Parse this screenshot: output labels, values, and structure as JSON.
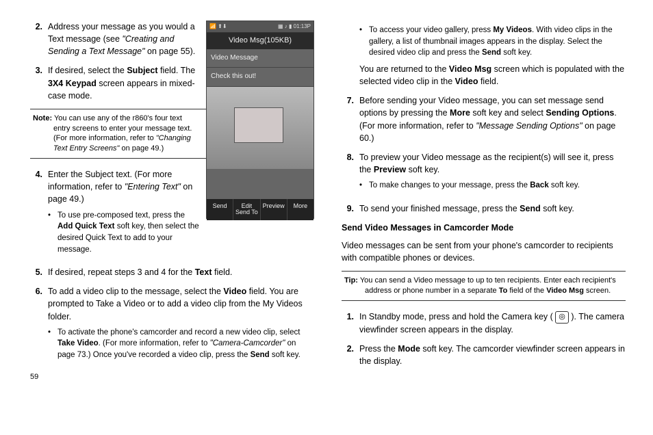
{
  "phone": {
    "status_left": "📶 ⬆⬇",
    "status_right": "▦ ♪ ▮ 01:13P",
    "title": "Video Msg(105KB)",
    "line1": "Video Message",
    "line2": "Check this out!",
    "sk1": "Send",
    "sk2a": "Edit",
    "sk2b": "Send To",
    "sk3": "Preview",
    "sk4": "More"
  },
  "left": {
    "i2_num": "2.",
    "i2a": "Address your message as you would a Text message (see ",
    "i2b": "\"Creating and Sending a Text Message\"",
    "i2c": " on page 55).",
    "i3_num": "3.",
    "i3a": "If desired, select the ",
    "i3b": "Subject",
    "i3c": " field. The ",
    "i3d": "3X4 Keypad",
    "i3e": " screen appears in mixed-case mode.",
    "note_label": "Note:",
    "note_a": " You can use any of the r860's four text entry screens to enter your message text. (For more information, refer to ",
    "note_b": "\"Changing Text Entry Screens\"",
    "note_c": "  on page 49.)",
    "i4_num": "4.",
    "i4a": "Enter the Subject text. (For more information, refer to ",
    "i4b": "\"Entering Text\"",
    "i4c": "  on page 49.)",
    "i4s_a": "To use pre-composed text, press the ",
    "i4s_b": "Add Quick Text",
    "i4s_c": " soft key, then select the desired Quick Text to add to your message.",
    "i5_num": "5.",
    "i5a": "If desired, repeat steps 3 and 4 for the ",
    "i5b": "Text",
    "i5c": " field.",
    "i6_num": "6.",
    "i6a": "To add a video clip to the message, select the ",
    "i6b": "Video",
    "i6c": " field. You are prompted to Take a Video or to add a video clip from the My Videos folder.",
    "i6s_a": "To activate the phone's camcorder and record a new video clip, select ",
    "i6s_b": "Take Video",
    "i6s_c": ". (For more information, refer to ",
    "i6s_d": "\"Camera-Camcorder\"",
    "i6s_e": "  on page 73.) Once you've recorded a video clip, press the ",
    "i6s_f": "Send",
    "i6s_g": " soft key.",
    "pagenum": "59"
  },
  "right": {
    "s0_a": "To access your video gallery, press ",
    "s0_b": "My Videos",
    "s0_c": ". With video clips in the gallery, a list of thumbnail images appears in the display. Select the desired video clip and press the ",
    "s0_d": "Send",
    "s0_e": " soft key.",
    "p0_a": "You are returned to the ",
    "p0_b": "Video Msg",
    "p0_c": " screen which is populated with the selected video clip in the ",
    "p0_d": "Video",
    "p0_e": " field.",
    "i7_num": "7.",
    "i7a": "Before sending your Video message, you can set message send options by pressing the ",
    "i7b": "More",
    "i7c": " soft key and select ",
    "i7d": "Sending Options",
    "i7e": ". (For more information, refer to ",
    "i7f": "\"Message Sending Options\"",
    "i7g": "  on page 60.)",
    "i8_num": "8.",
    "i8a": "To preview your Video message as the recipient(s) will see it, press the ",
    "i8b": "Preview",
    "i8c": " soft key.",
    "i8s_a": "To make changes to your message, press the ",
    "i8s_b": "Back",
    "i8s_c": " soft key.",
    "i9_num": "9.",
    "i9a": "To send your finished message, press the ",
    "i9b": "Send",
    "i9c": " soft key.",
    "subhead": "Send Video Messages in Camcorder Mode",
    "para": "Video messages can be sent from your phone's camcorder to recipients with compatible phones or devices.",
    "tip_label": "Tip:",
    "tip_a": " You can send a Video message to up to ten recipients. Enter each recipient's address or phone number in a separate ",
    "tip_b": "To",
    "tip_c": " field of the ",
    "tip_d": "Video Msg",
    "tip_e": " screen.",
    "j1_num": "1.",
    "j1a": "In Standby mode, press and hold the Camera key ( ",
    "j1b": " ). The camera viewfinder screen appears in the display.",
    "j2_num": "2.",
    "j2a": "Press the ",
    "j2b": "Mode",
    "j2c": " soft key. The camcorder viewfinder screen appears in the display."
  }
}
